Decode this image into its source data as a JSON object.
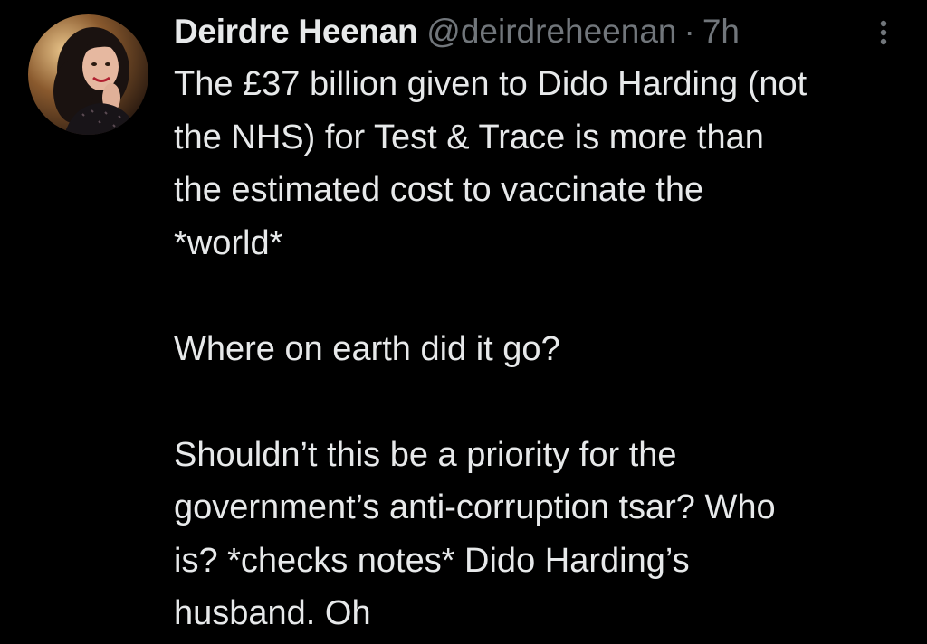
{
  "tweet": {
    "author": {
      "display_name": "Deirdre Heenan",
      "handle": "@deirdreheenan",
      "separator": "·",
      "time": "7h",
      "avatar_icon": "profile-photo"
    },
    "more_icon": "vertical-ellipsis-icon",
    "body": {
      "paragraph1": [
        "The £37 billion given to Dido Harding (not",
        "the NHS)  for Test & Trace is more than",
        "the estimated cost to vaccinate the",
        "*world*"
      ],
      "paragraph2": [
        "Where on earth did it go?"
      ],
      "paragraph3": [
        "Shouldn’t this be a priority for the",
        "government’s anti-corruption tsar? Who",
        "is? *checks notes* Dido Harding’s",
        "husband. Oh"
      ]
    }
  },
  "colors": {
    "background": "#000000",
    "primary_text": "#e7e9ea",
    "secondary_text": "#71767b"
  }
}
